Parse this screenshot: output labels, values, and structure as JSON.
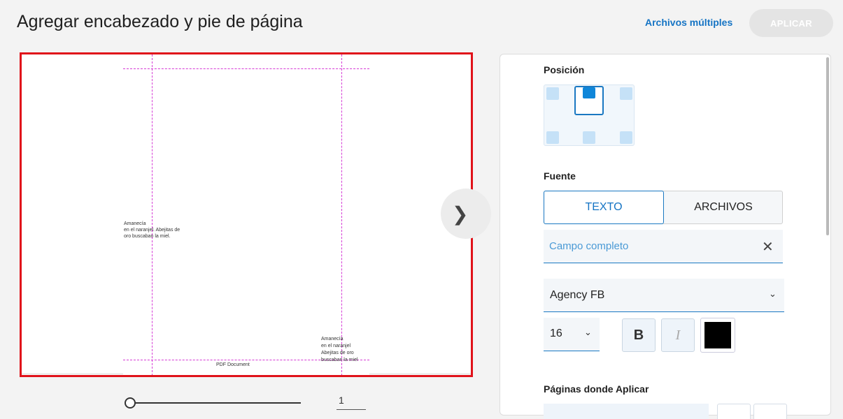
{
  "header": {
    "title": "Agregar encabezado y pie de página",
    "multi_files_link": "Archivos múltiples",
    "apply_button": "APLICAR"
  },
  "preview": {
    "body_text": [
      "Amanecía",
      "en el naranjel. Abejitas de",
      "oro buscaban la miel."
    ],
    "footer_right_text": [
      "Amanecía",
      "en el naranjel",
      "Abejitas de oro",
      "buscaban la miel"
    ],
    "footer_center_text": "PDF Document",
    "next_icon": "chevron-right-icon"
  },
  "pager": {
    "current_page": "1"
  },
  "panel": {
    "position_label": "Posición",
    "source_label": "Fuente",
    "source_tabs": {
      "text": "TEXTO",
      "files": "ARCHIVOS",
      "selected": "TEXTO"
    },
    "text_field_value": "Campo completo",
    "clear_icon": "close-icon",
    "font_family_value": "Agency FB",
    "font_size_value": "16",
    "bold_label": "B",
    "italic_label": "I",
    "font_color": "#000000",
    "pages_label": "Páginas donde Aplicar"
  },
  "colors": {
    "accent": "#1a78c2",
    "preview_border": "#e0121a",
    "guide": "#d63ad6"
  }
}
